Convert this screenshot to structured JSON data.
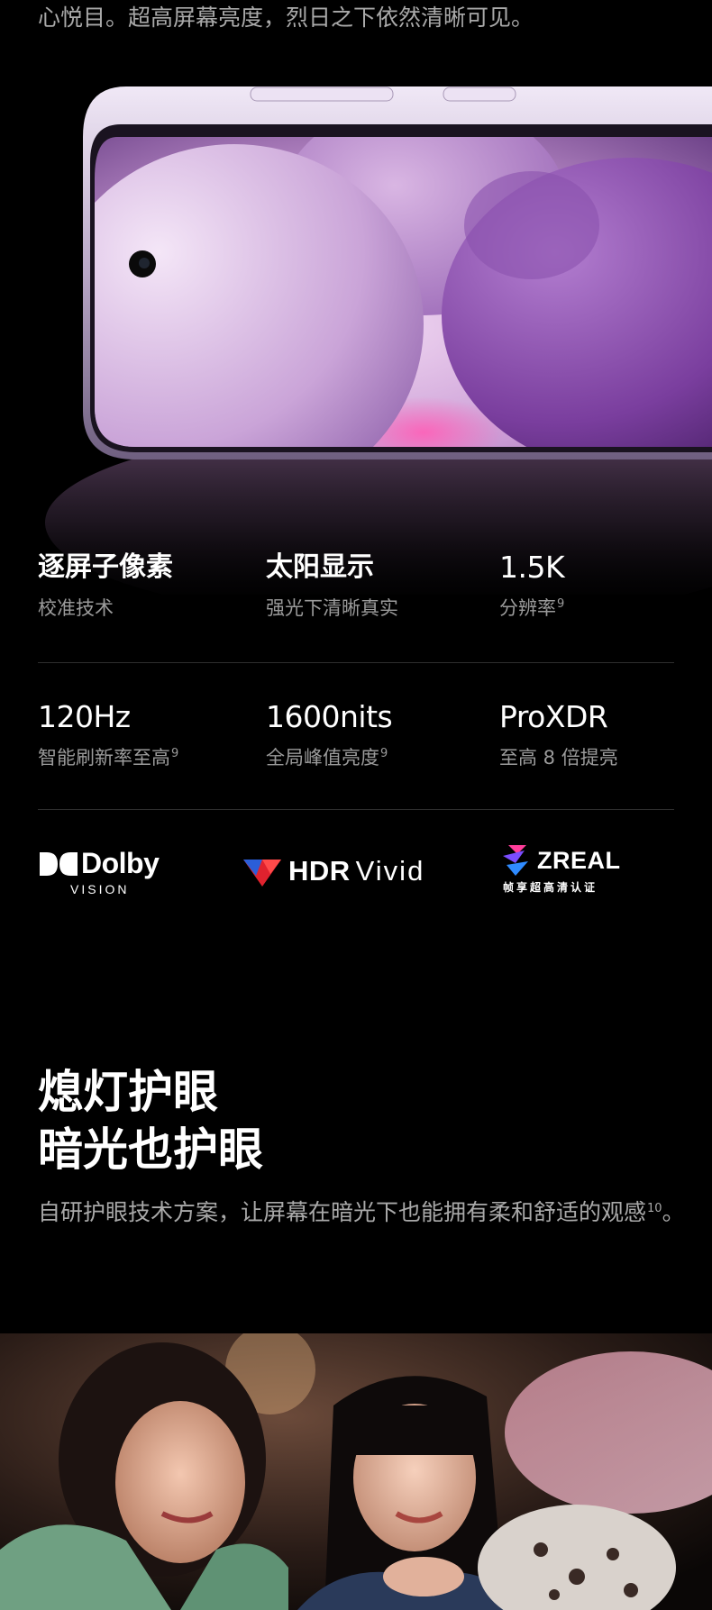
{
  "intro": {
    "text": "心悦目。超高屏幕亮度，烈日之下依然清晰可见。"
  },
  "specs": {
    "row1": [
      {
        "title": "逐屏子像素",
        "sub": "校准技术",
        "sup": ""
      },
      {
        "title": "太阳显示",
        "sub": "强光下清晰真实",
        "sup": ""
      },
      {
        "title": "1.5K",
        "sub": "分辨率",
        "sup": "9"
      }
    ],
    "row2": [
      {
        "title": "120Hz",
        "sub": "智能刷新率至高",
        "sup": "9"
      },
      {
        "title": "1600nits",
        "sub": "全局峰值亮度",
        "sup": "9"
      },
      {
        "title": "ProXDR",
        "sub": "至高 8 倍提亮",
        "sup": ""
      }
    ]
  },
  "logos": {
    "dolby": {
      "word": "Dolby",
      "sub": "VISION"
    },
    "hdr": {
      "word1": "HDR",
      "word2": "Vivid"
    },
    "zreal": {
      "word": "ZREAL",
      "sub": "帧享超高清认证"
    }
  },
  "eye": {
    "title_line1": "熄灯护眼",
    "title_line2": "暗光也护眼",
    "desc": "自研护眼技术方案，让屏幕在暗光下也能拥有柔和舒适的观感",
    "desc_sup": "10",
    "desc_end": "。"
  },
  "colors": {
    "background": "#000000",
    "text_primary": "#ffffff",
    "text_secondary": "#9b9b9b",
    "phone_purple": "#8a5fb0"
  }
}
